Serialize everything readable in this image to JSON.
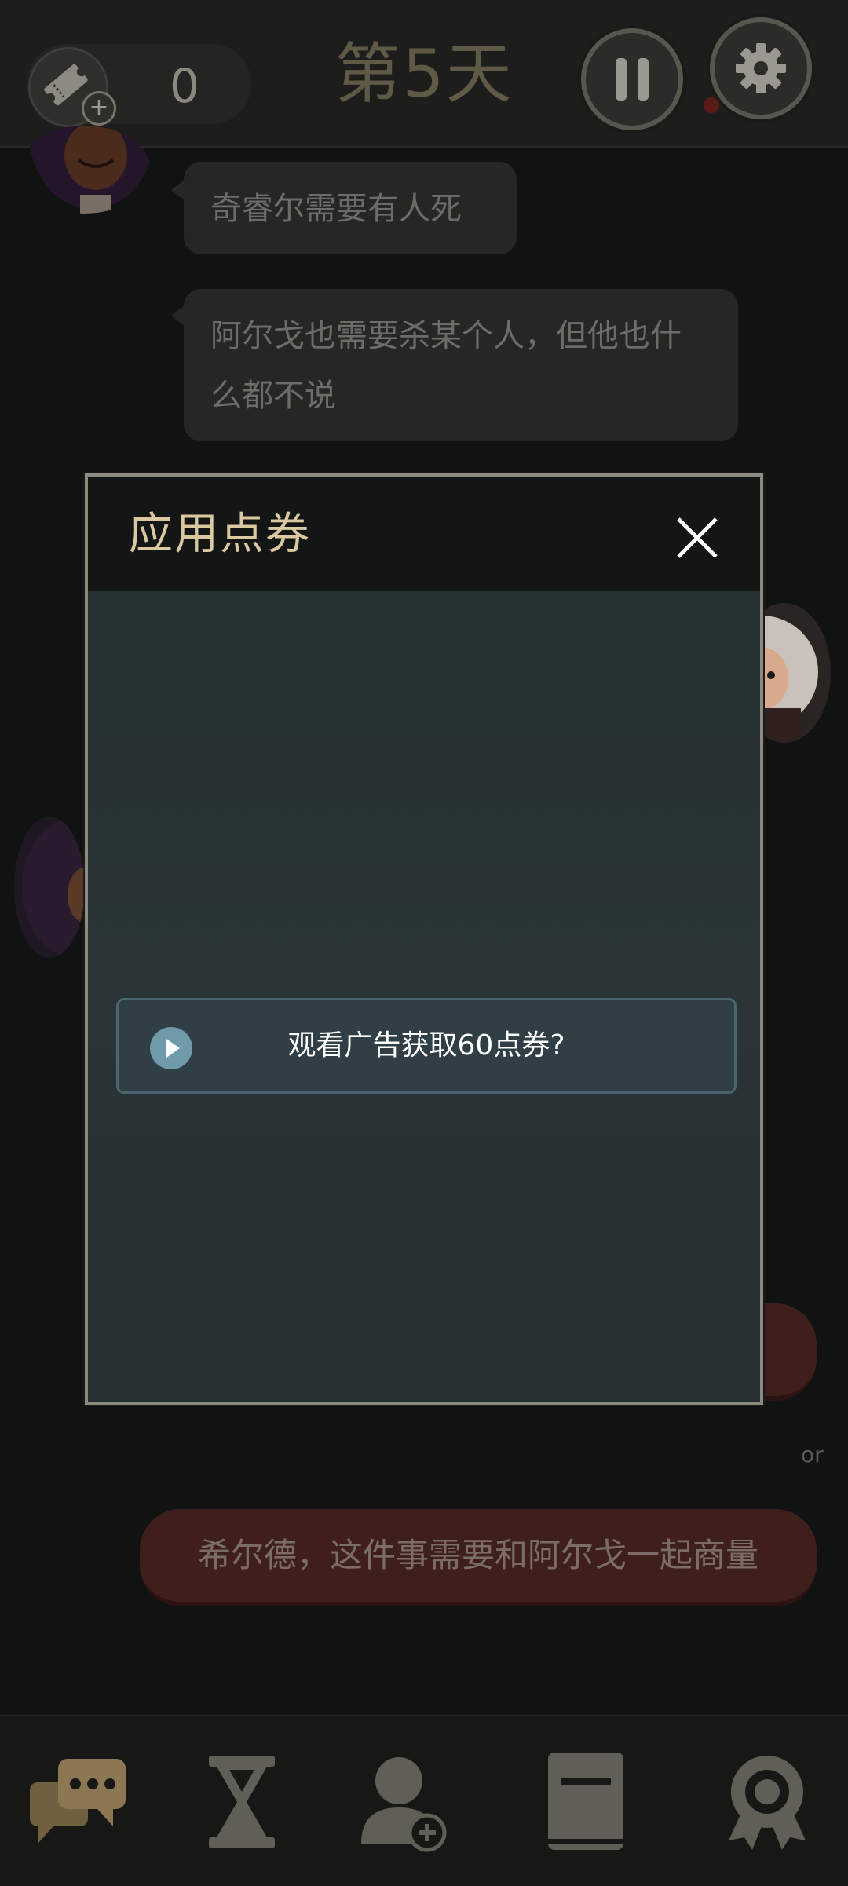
{
  "header": {
    "ticket_count": "0",
    "day_title": "第5天"
  },
  "chat": {
    "messages": [
      {
        "text": "奇睿尔需要有人死"
      },
      {
        "text": "阿尔戈也需要杀某个人，但他也什么都不说"
      }
    ],
    "or_label": "or",
    "choice": "希尔德，这件事需要和阿尔戈一起商量"
  },
  "modal": {
    "title": "应用点券",
    "ad_button_label": "观看广告获取60点券?"
  },
  "bottom_nav": {
    "items": [
      "chat-icon",
      "hourglass-icon",
      "add-user-icon",
      "book-icon",
      "award-icon"
    ]
  },
  "colors": {
    "accent_gold": "#d9c8a0",
    "choice_red": "#3e1f1c",
    "ad_button_border": "#4a6470",
    "play_icon": "#6e9aaa"
  }
}
